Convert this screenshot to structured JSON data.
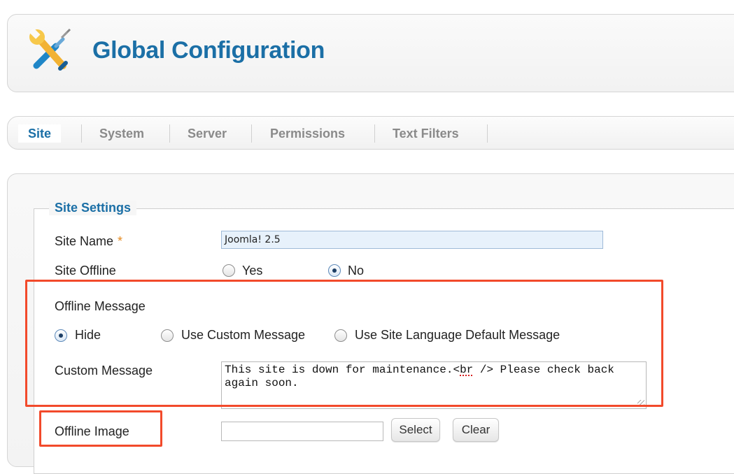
{
  "header": {
    "title": "Global Configuration",
    "icon": "tools-icon"
  },
  "tabs": [
    {
      "label": "Site",
      "active": true
    },
    {
      "label": "System",
      "active": false
    },
    {
      "label": "Server",
      "active": false
    },
    {
      "label": "Permissions",
      "active": false
    },
    {
      "label": "Text Filters",
      "active": false
    }
  ],
  "site_settings": {
    "legend": "Site Settings",
    "site_name": {
      "label": "Site Name",
      "required_mark": "*",
      "value": "Joomla! 2.5"
    },
    "site_offline": {
      "label": "Site Offline",
      "options": [
        "Yes",
        "No"
      ],
      "selected": "No"
    },
    "offline_message": {
      "label": "Offline Message",
      "options": [
        "Hide",
        "Use Custom Message",
        "Use Site Language Default Message"
      ],
      "selected": "Hide"
    },
    "custom_message": {
      "label": "Custom Message",
      "value_part1": "This site is down for maintenance.<",
      "value_flagged": "br",
      "value_part2": " /> Please check back again soon."
    },
    "offline_image": {
      "label": "Offline Image",
      "value": "",
      "select_label": "Select",
      "clear_label": "Clear"
    }
  },
  "colors": {
    "accent": "#1b6fa6",
    "highlight": "#f24a2b",
    "required": "#e58a1f"
  }
}
